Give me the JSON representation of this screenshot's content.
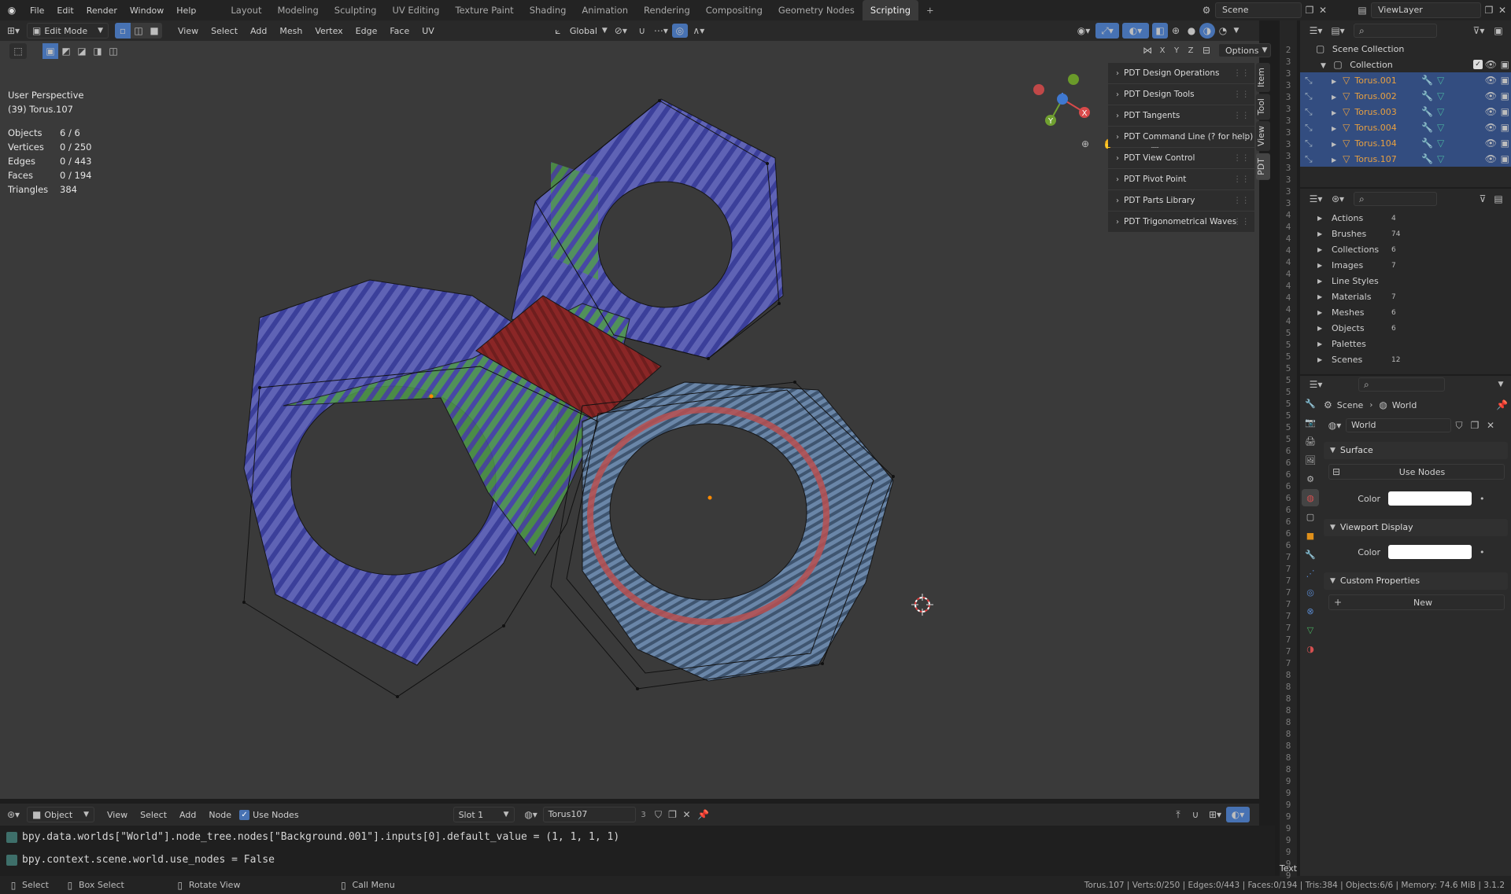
{
  "topbar": {
    "menus": [
      "File",
      "Edit",
      "Render",
      "Window",
      "Help"
    ],
    "workspaces": [
      "Layout",
      "Modeling",
      "Sculpting",
      "UV Editing",
      "Texture Paint",
      "Shading",
      "Animation",
      "Rendering",
      "Compositing",
      "Geometry Nodes",
      "Scripting"
    ],
    "active_workspace": "Scripting",
    "add_tab": "+",
    "scene": "Scene",
    "view_layer": "ViewLayer"
  },
  "viewport": {
    "mode": "Edit Mode",
    "menus": [
      "View",
      "Select",
      "Add",
      "Mesh",
      "Vertex",
      "Edge",
      "Face",
      "UV"
    ],
    "transform_orientation": "Global",
    "options_label": "Options",
    "axes": [
      "X",
      "Y",
      "Z"
    ],
    "perspective": "User Perspective",
    "active_object": "(39) Torus.107",
    "stats": [
      {
        "label": "Objects",
        "value": "6 / 6"
      },
      {
        "label": "Vertices",
        "value": "0 / 250"
      },
      {
        "label": "Edges",
        "value": "0 / 443"
      },
      {
        "label": "Faces",
        "value": "0 / 194"
      },
      {
        "label": "Triangles",
        "value": "384"
      }
    ]
  },
  "npanel": {
    "items": [
      "PDT Design Operations",
      "PDT Design Tools",
      "PDT Tangents",
      "PDT Command Line (? for help)",
      "PDT View Control",
      "PDT Pivot Point",
      "PDT Parts Library",
      "PDT Trigonometrical Waves"
    ],
    "tabs": [
      "Item",
      "Tool",
      "View",
      "PDT"
    ],
    "active_tab": "PDT"
  },
  "bottom_header": {
    "mode": "Object",
    "menus": [
      "View",
      "Select",
      "Add",
      "Node"
    ],
    "use_nodes": "Use Nodes",
    "slot": "Slot 1",
    "material": "Torus107",
    "users": "3"
  },
  "console": {
    "lines": [
      "bpy.data.worlds[\"World\"].node_tree.nodes[\"Background.001\"].inputs[0].default_value = (1, 1, 1, 1)",
      "bpy.context.scene.world.use_nodes = False"
    ]
  },
  "statusbar": {
    "select": "Select",
    "box_select": "Box Select",
    "rotate_view": "Rotate View",
    "call_menu": "Call Menu",
    "info": "Torus.107 | Verts:0/250 | Edges:0/443 | Faces:0/194 | Tris:384 | Objects:6/6 | Memory: 74.6 MiB | 3.1.2"
  },
  "gutter": {
    "numbers": [
      "2",
      "3",
      "3",
      "3",
      "3",
      "3",
      "3",
      "3",
      "3",
      "3",
      "3",
      "3",
      "3",
      "3",
      "4",
      "4",
      "4",
      "4",
      "4",
      "4",
      "4",
      "4",
      "4",
      "4",
      "5",
      "5",
      "5",
      "5",
      "5",
      "5",
      "5",
      "5",
      "5",
      "5",
      "6",
      "6",
      "6",
      "6",
      "6",
      "6",
      "6",
      "6",
      "6",
      "7",
      "7",
      "7",
      "7",
      "7",
      "7",
      "7",
      "7",
      "7",
      "7",
      "8",
      "8",
      "8",
      "8",
      "8",
      "8",
      "8",
      "8",
      "8",
      "9",
      "9",
      "9",
      "9",
      "9",
      "9",
      "9",
      "9",
      "9"
    ],
    "footer": "Text"
  },
  "outliner": {
    "scene_collection": "Scene Collection",
    "collection": "Collection",
    "objects": [
      "Torus.001",
      "Torus.002",
      "Torus.003",
      "Torus.004",
      "Torus.104",
      "Torus.107"
    ]
  },
  "datablocks": {
    "items": [
      {
        "label": "Actions",
        "count": "4"
      },
      {
        "label": "Brushes",
        "count": "74"
      },
      {
        "label": "Collections",
        "count": "6"
      },
      {
        "label": "Images",
        "count": "7"
      },
      {
        "label": "Line Styles",
        "count": ""
      },
      {
        "label": "Materials",
        "count": "7"
      },
      {
        "label": "Meshes",
        "count": "6"
      },
      {
        "label": "Objects",
        "count": "6"
      },
      {
        "label": "Palettes",
        "count": ""
      },
      {
        "label": "Scenes",
        "count": "12"
      }
    ]
  },
  "properties": {
    "breadcrumb": [
      "Scene",
      "World"
    ],
    "world_name": "World",
    "surface": "Surface",
    "use_nodes_btn": "Use Nodes",
    "color_label": "Color",
    "viewport_display": "Viewport Display",
    "custom_properties": "Custom Properties",
    "new_btn": "New"
  },
  "colors": {
    "accent": "#4772b3",
    "selected_row": "#334d80",
    "object_name": "#e8a040"
  }
}
